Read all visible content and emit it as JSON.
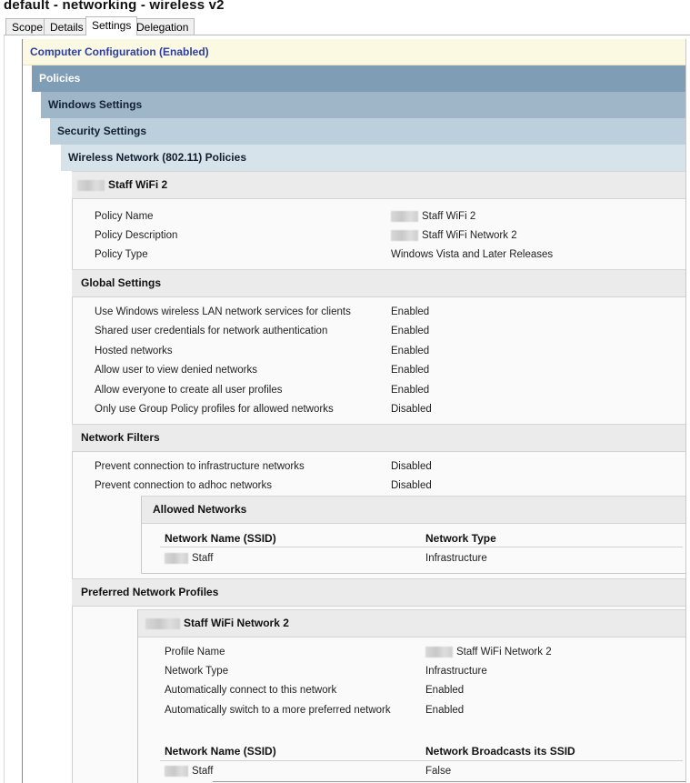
{
  "window": {
    "title": "default - networking - wireless v2"
  },
  "tabs": [
    "Scope",
    "Details",
    "Settings",
    "Delegation"
  ],
  "bars": {
    "config": "Computer Configuration (Enabled)",
    "policies": "Policies",
    "windows": "Windows Settings",
    "security": "Security Settings",
    "wireless": "Wireless Network (802.11) Policies"
  },
  "policy": {
    "header": "Staff WiFi 2",
    "rows": [
      {
        "label": "Policy Name",
        "value": "Staff WiFi 2"
      },
      {
        "label": "Policy Description",
        "value": "Staff WiFi Network 2"
      },
      {
        "label": "Policy Type",
        "value": "Windows Vista and Later Releases"
      }
    ]
  },
  "global": {
    "header": "Global Settings",
    "rows": [
      {
        "label": "Use Windows wireless LAN network services for clients",
        "value": "Enabled"
      },
      {
        "label": "Shared user credentials for network authentication",
        "value": "Enabled"
      },
      {
        "label": "Hosted networks",
        "value": "Enabled"
      },
      {
        "label": "Allow user to view denied networks",
        "value": "Enabled"
      },
      {
        "label": "Allow everyone to create all user profiles",
        "value": "Enabled"
      },
      {
        "label": "Only use Group Policy profiles for allowed networks",
        "value": "Disabled"
      }
    ]
  },
  "filters": {
    "header": "Network Filters",
    "rows": [
      {
        "label": "Prevent connection to infrastructure networks",
        "value": "Disabled"
      },
      {
        "label": "Prevent connection to adhoc networks",
        "value": "Disabled"
      }
    ],
    "allowed": {
      "header": "Allowed Networks",
      "columns": [
        "Network Name (SSID)",
        "Network Type"
      ],
      "rows": [
        {
          "name": "Staff",
          "type": "Infrastructure"
        }
      ]
    }
  },
  "preferred": {
    "header": "Preferred Network Profiles",
    "profile_header": "Staff WiFi Network 2",
    "rows": [
      {
        "label": "Profile Name",
        "value": "Staff WiFi Network 2"
      },
      {
        "label": "Network Type",
        "value": "Infrastructure"
      },
      {
        "label": "Automatically connect to this network",
        "value": "Enabled"
      },
      {
        "label": "Automatically switch to a more preferred network",
        "value": "Enabled"
      }
    ],
    "ssid_table": {
      "columns": [
        "Network Name (SSID)",
        "Network Broadcasts its SSID"
      ],
      "rows": [
        {
          "name": "Staff",
          "broadcast": "False"
        }
      ]
    }
  }
}
